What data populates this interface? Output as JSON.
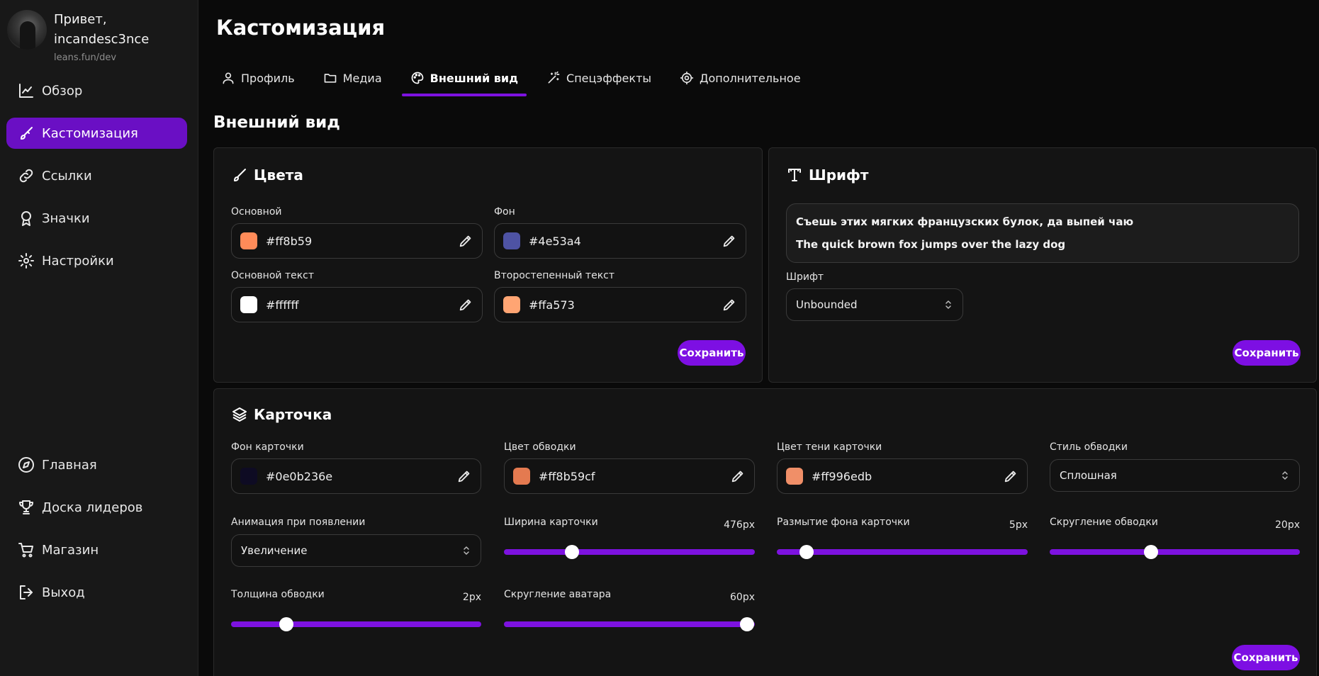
{
  "user": {
    "greeting_line1": "Привет,",
    "greeting_line2": "incandesc3nce",
    "site": "leans.fun/dev"
  },
  "sidebar": {
    "top_items": [
      {
        "label": "Обзор",
        "icon": "chart-icon"
      },
      {
        "label": "Кастомизация",
        "icon": "brush-icon",
        "active": true
      },
      {
        "label": "Ссылки",
        "icon": "link-icon"
      },
      {
        "label": "Значки",
        "icon": "badge-icon"
      },
      {
        "label": "Настройки",
        "icon": "gear-icon"
      }
    ],
    "bottom_items": [
      {
        "label": "Главная",
        "icon": "compass-icon"
      },
      {
        "label": "Доска лидеров",
        "icon": "trophy-icon"
      },
      {
        "label": "Магазин",
        "icon": "cart-icon"
      },
      {
        "label": "Выход",
        "icon": "logout-icon"
      }
    ]
  },
  "page": {
    "title": "Кастомизация",
    "section_title": "Внешний вид"
  },
  "tabs": [
    {
      "label": "Профиль",
      "icon": "user-icon"
    },
    {
      "label": "Медиа",
      "icon": "folder-icon"
    },
    {
      "label": "Внешний вид",
      "icon": "palette-icon",
      "active": true
    },
    {
      "label": "Спецэффекты",
      "icon": "magic-wand-icon"
    },
    {
      "label": "Дополнительное",
      "icon": "gear-icon"
    }
  ],
  "colors_card": {
    "title": "Цвета",
    "primary": {
      "label": "Основной",
      "value": "#ff8b59",
      "swatch": "#ff8b59"
    },
    "background": {
      "label": "Фон",
      "value": "#4e53a4",
      "swatch": "#4e53a4"
    },
    "primary_text": {
      "label": "Основной текст",
      "value": "#ffffff",
      "swatch": "#ffffff"
    },
    "secondary_text": {
      "label": "Второстепенный текст",
      "value": "#ffa573",
      "swatch": "#ffa573"
    },
    "save_label": "Сохранить"
  },
  "font_card": {
    "title": "Шрифт",
    "preview_ru": "Съешь этих мягких французских булок, да выпей чаю",
    "preview_en": "The quick brown fox jumps over the lazy dog",
    "font_label": "Шрифт",
    "font_value": "Unbounded",
    "save_label": "Сохранить"
  },
  "card_card": {
    "title": "Карточка",
    "card_bg": {
      "label": "Фон карточки",
      "value": "#0e0b236e",
      "swatch": "#0e0b23"
    },
    "border_color": {
      "label": "Цвет обводки",
      "value": "#ff8b59cf",
      "swatch": "#e47a50"
    },
    "shadow_color": {
      "label": "Цвет тени карточки",
      "value": "#ff996edb",
      "swatch": "#f08f68"
    },
    "border_style": {
      "label": "Стиль обводки",
      "value": "Сплошная"
    },
    "animation": {
      "label": "Анимация при появлении",
      "value": "Увеличение"
    },
    "card_width": {
      "label": "Ширина карточки",
      "value": "476px",
      "fraction": 0.27
    },
    "bg_blur": {
      "label": "Размытие фона карточки",
      "value": "5px",
      "fraction": 0.12
    },
    "border_radius": {
      "label": "Скругление обводки",
      "value": "20px",
      "fraction": 0.405
    },
    "border_width": {
      "label": "Толщина обводки",
      "value": "2px",
      "fraction": 0.22
    },
    "avatar_radius": {
      "label": "Скругление аватара",
      "value": "60px",
      "fraction": 0.97
    },
    "save_label": "Сохранить"
  },
  "colors": {
    "accent": "#7d12e0",
    "active_nav": "#6a0fc4"
  }
}
